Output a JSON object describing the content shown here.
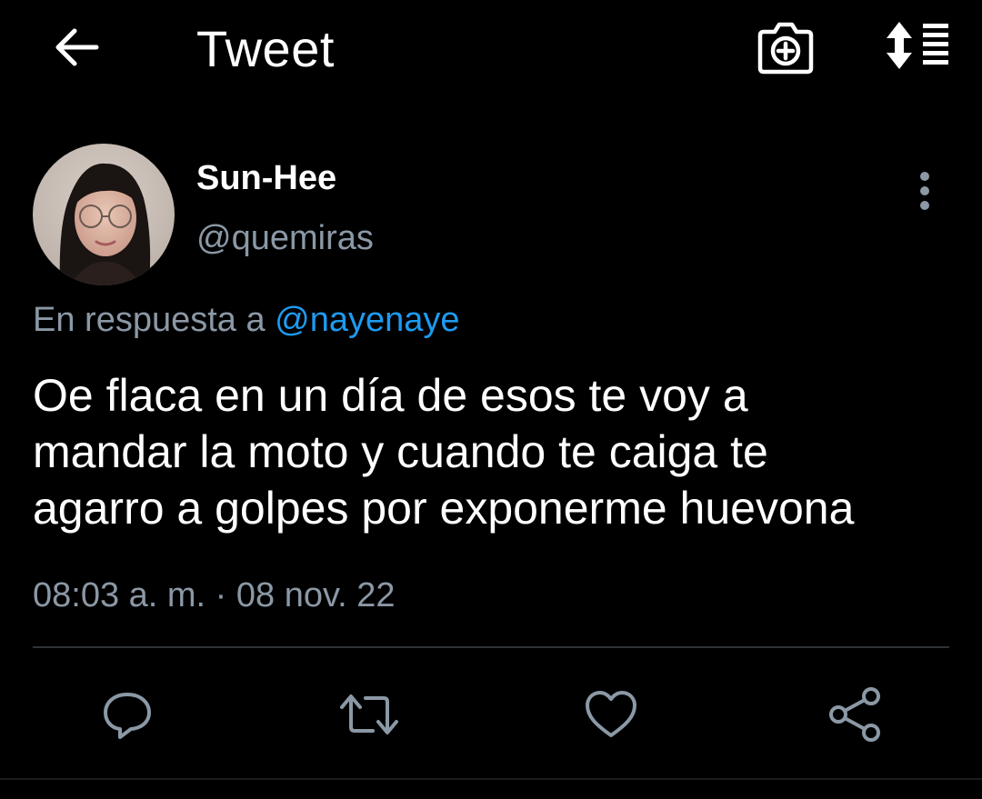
{
  "header": {
    "title": "Tweet",
    "back_icon": "arrow-left-icon",
    "camera_icon": "camera-plus-icon",
    "sort_icon": "sort-list-icon"
  },
  "tweet": {
    "author": {
      "display_name": "Sun-Hee",
      "handle": "@quemiras"
    },
    "reply": {
      "prefix": "En respuesta a",
      "mention": "@nayenaye"
    },
    "text_lines": [
      "Oe flaca en un día de esos te voy a",
      "mandar la moto y cuando te caiga te",
      "agarro a golpes por exponerme huevona"
    ],
    "timestamp": "08:03 a. m. · 08 nov. 22"
  },
  "actions": {
    "icons": [
      "reply-icon",
      "retweet-icon",
      "like-icon",
      "share-icon"
    ]
  },
  "colors": {
    "background": "#000000",
    "text_primary": "#ffffff",
    "text_secondary": "#8b98a5",
    "link": "#1d9bf0",
    "divider": "#2f3336"
  }
}
